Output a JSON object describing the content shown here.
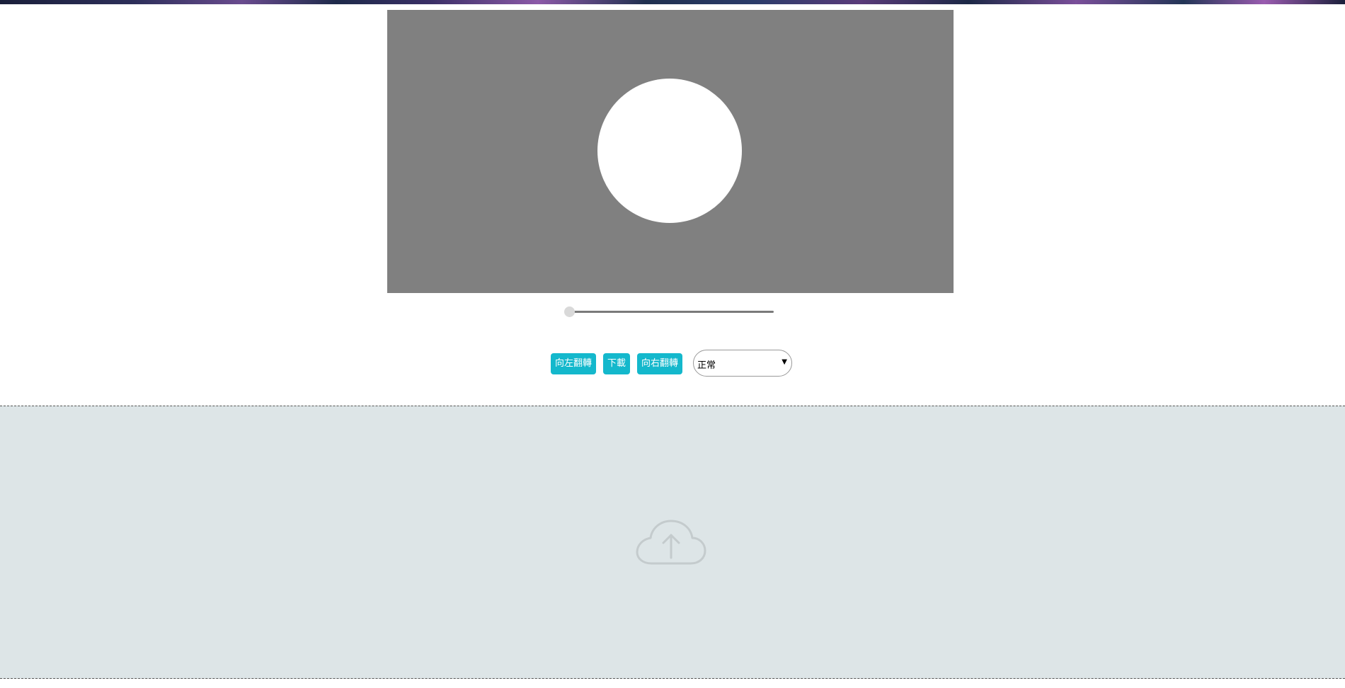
{
  "editor": {
    "canvas_bg": "#808080",
    "crop_shape": "circle"
  },
  "zoom": {
    "value": 0
  },
  "toolbar": {
    "rotate_left_label": "向左翻轉",
    "download_label": "下載",
    "rotate_right_label": "向右翻轉",
    "button_color": "#14b8cc"
  },
  "mode_select": {
    "value": "正常"
  },
  "upload": {
    "icon": "cloud-upload-icon",
    "bg_color": "#dde5e7"
  }
}
